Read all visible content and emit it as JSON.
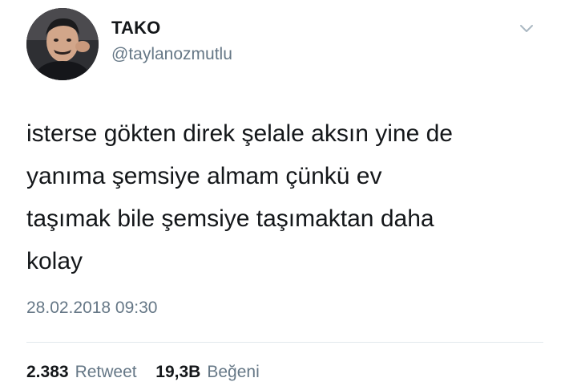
{
  "author": {
    "display_name": "TAKO",
    "username": "@taylanozmutlu"
  },
  "tweet": {
    "lines": [
      "isterse gökten direk şelale aksın yine de",
      "yanıma şemsiye almam çünkü ev",
      "taşımak bile şemsiye taşımaktan daha",
      "kolay"
    ],
    "timestamp": "28.02.2018 09:30"
  },
  "stats": {
    "retweet_count": "2.383",
    "retweet_label": "Retweet",
    "like_count": "19,3B",
    "like_label": "Beğeni"
  },
  "icons": {
    "menu": "chevron-down-icon"
  },
  "colors": {
    "text_primary": "#14171a",
    "text_secondary": "#657786",
    "divider": "#e1e8ed"
  }
}
